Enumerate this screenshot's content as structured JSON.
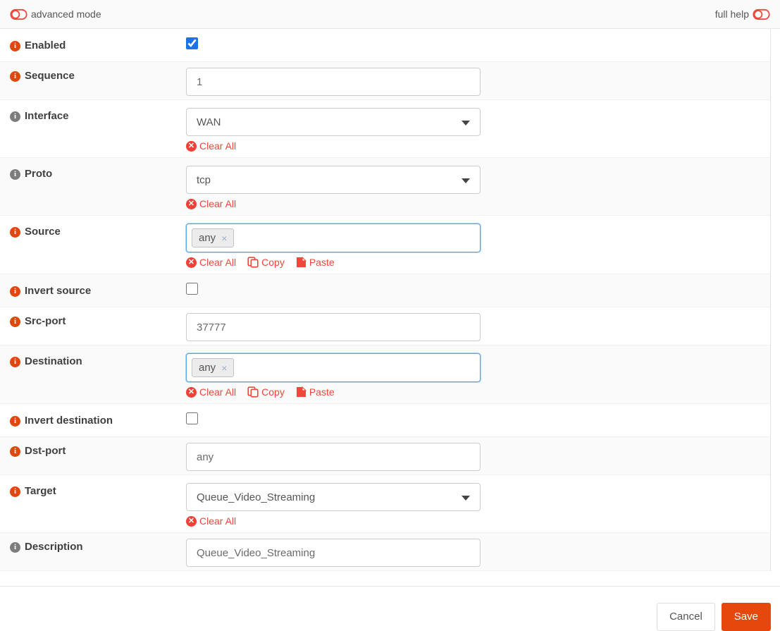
{
  "colors": {
    "primary_orange": "#e5470c",
    "danger_red": "#f0463c",
    "checkbox_blue": "#1a73e8",
    "token_border_blue": "#58a6e8"
  },
  "topbar": {
    "advanced_mode_label": "advanced mode",
    "full_help_label": "full help"
  },
  "rows": {
    "enabled": {
      "label": "Enabled",
      "checked": true
    },
    "sequence": {
      "label": "Sequence",
      "value": "1"
    },
    "interface": {
      "label": "Interface",
      "value": "WAN",
      "clear_all": "Clear All"
    },
    "proto": {
      "label": "Proto",
      "value": "tcp",
      "clear_all": "Clear All"
    },
    "source": {
      "label": "Source",
      "tags": [
        "any"
      ],
      "remove_glyph": "×",
      "clear_all": "Clear All",
      "copy": "Copy",
      "paste": "Paste"
    },
    "invert_source": {
      "label": "Invert source",
      "checked": false
    },
    "src_port": {
      "label": "Src-port",
      "value": "37777"
    },
    "destination": {
      "label": "Destination",
      "tags": [
        "any"
      ],
      "remove_glyph": "×",
      "clear_all": "Clear All",
      "copy": "Copy",
      "paste": "Paste"
    },
    "invert_destination": {
      "label": "Invert destination",
      "checked": false
    },
    "dst_port": {
      "label": "Dst-port",
      "value": "any"
    },
    "target": {
      "label": "Target",
      "value": "Queue_Video_Streaming",
      "clear_all": "Clear All"
    },
    "description": {
      "label": "Description",
      "value": "Queue_Video_Streaming"
    }
  },
  "icons": {
    "info": "i",
    "times": "✕"
  },
  "footer": {
    "cancel_label": "Cancel",
    "save_label": "Save"
  }
}
